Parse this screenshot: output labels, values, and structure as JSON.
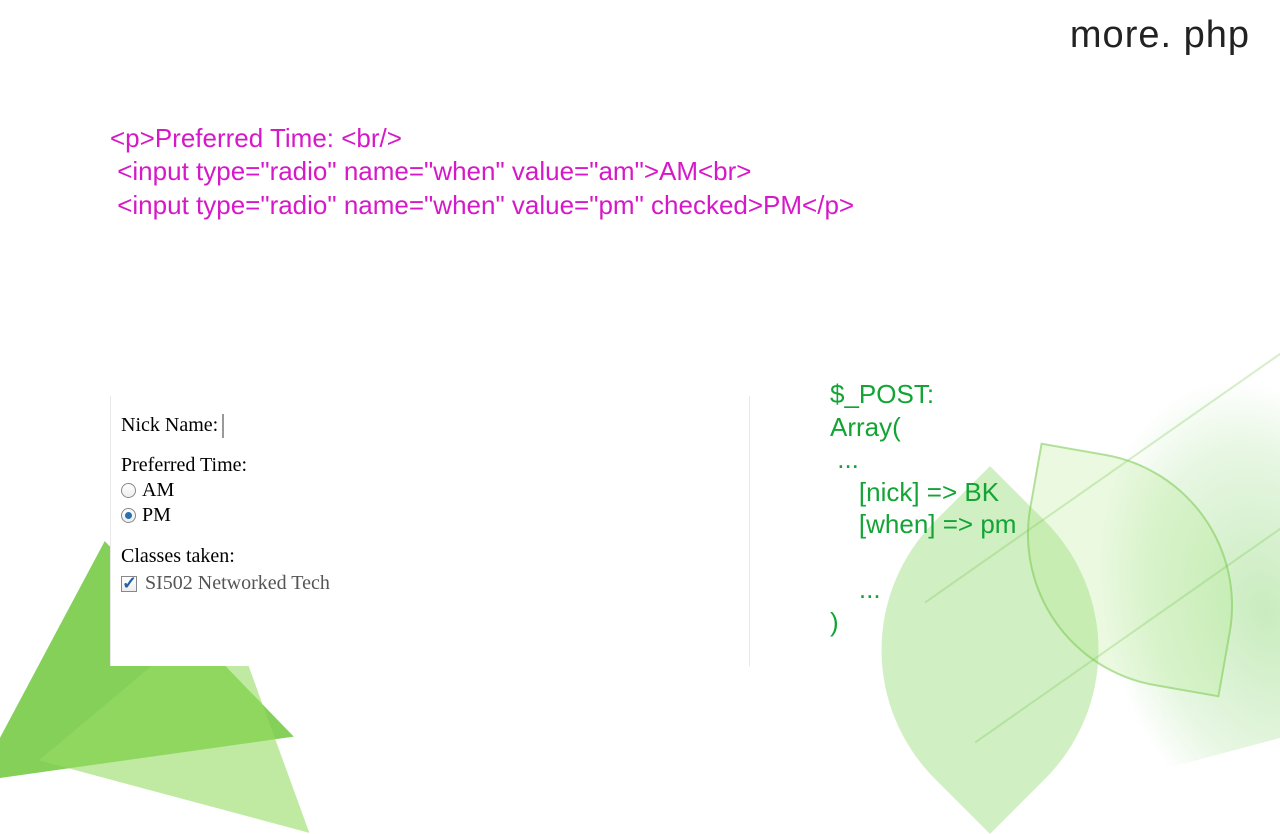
{
  "title": "more. php",
  "code": {
    "line1": "<p>Preferred Time: <br/>",
    "line2": " <input type=\"radio\" name=\"when\" value=\"am\">AM<br>",
    "line3": " <input type=\"radio\" name=\"when\" value=\"pm\" checked>PM</p>"
  },
  "form": {
    "nick_label": "Nick Name:",
    "preferred_time_label": "Preferred Time:",
    "am_label": "AM",
    "pm_label": "PM",
    "classes_label": "Classes taken:",
    "class_row": "SI502   Networked Tech"
  },
  "post": {
    "l1": "$_POST:",
    "l2": "Array(",
    "l3": " ...",
    "l4": "    [nick] => BK",
    "l5": "    [when] => pm",
    "l6": "",
    "l7": "    ...",
    "l8": ")"
  }
}
